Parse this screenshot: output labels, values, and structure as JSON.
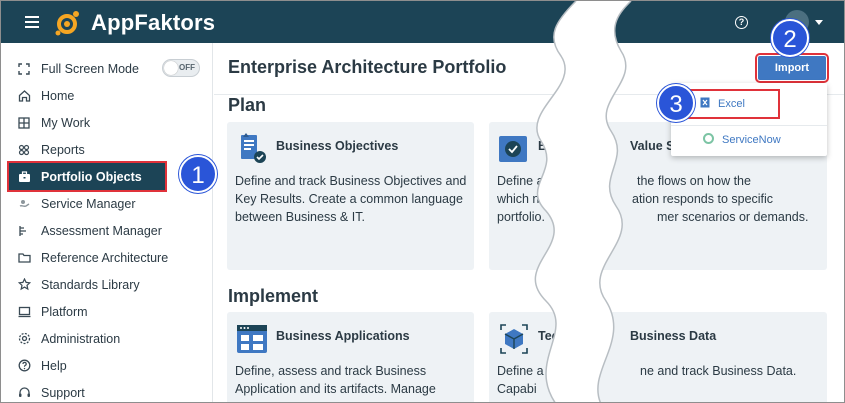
{
  "topbar": {
    "brand": "AppFaktors",
    "help_glyph": "?"
  },
  "sidebar": {
    "items": [
      {
        "label": "Full Screen Mode",
        "icon": "fullscreen-icon"
      },
      {
        "label": "Home",
        "icon": "home-icon"
      },
      {
        "label": "My Work",
        "icon": "grid-icon"
      },
      {
        "label": "Reports",
        "icon": "reports-icon"
      },
      {
        "label": "Portfolio Objects",
        "icon": "briefcase-icon",
        "active": true
      },
      {
        "label": "Service Manager",
        "icon": "service-icon"
      },
      {
        "label": "Assessment Manager",
        "icon": "assessment-icon"
      },
      {
        "label": "Reference Architecture",
        "icon": "folder-icon"
      },
      {
        "label": "Standards Library",
        "icon": "star-icon"
      },
      {
        "label": "Platform",
        "icon": "monitor-icon"
      },
      {
        "label": "Administration",
        "icon": "gear-icon"
      },
      {
        "label": "Help",
        "icon": "help-icon"
      },
      {
        "label": "Support",
        "icon": "headset-icon"
      }
    ],
    "fullscreen_toggle": "OFF"
  },
  "main": {
    "page_title": "Enterprise Architecture Portfolio",
    "import_label": "Import",
    "import_menu": {
      "excel": "Excel",
      "servicenow": "ServiceNow"
    },
    "sections": [
      {
        "title": "Plan",
        "cards": [
          {
            "title": "Business Objectives",
            "desc": "Define and track Business Objectives and Key Results. Create a common language between Business & IT."
          },
          {
            "title": "Bu",
            "desc": "Define and t     the flows on how the which need     ation responds to specific portfolio.     mer scenarios or demands."
          }
        ]
      },
      {
        "title": "Implement",
        "cards": [
          {
            "title": "Business Applications",
            "desc": "Define, assess and track Business Application and its artifacts. Manage"
          },
          {
            "title": "Tec",
            "desc": "Define a     ne and track Business Data. Capabi"
          }
        ]
      }
    ],
    "visible_fragments": {
      "value_s": "Value S",
      "business_data": "Business Data",
      "plan_card2_line1_tail": "the flows on how the",
      "plan_card2_line2_tail": "ation responds to specific",
      "plan_card2_line3_tail": "mer scenarios or demands.",
      "impl_card2_line1_tail": "ne and track Business Data."
    }
  },
  "callouts": [
    "1",
    "2",
    "3"
  ],
  "colors": {
    "topbar": "#1c4456",
    "accent_blue": "#3f78c2",
    "highlight_red": "#e0323a",
    "callout_blue": "#2a55d8",
    "logo_orange": "#f5a623"
  }
}
